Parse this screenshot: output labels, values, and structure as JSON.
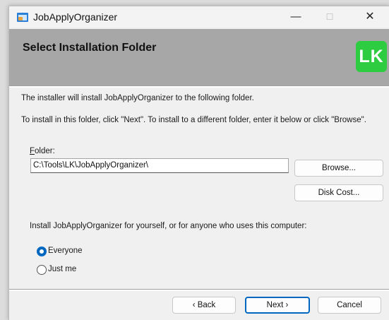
{
  "window": {
    "title": "JobApplyOrganizer",
    "controls": {
      "minimize": "—",
      "maximize": "☐",
      "close": "✕"
    }
  },
  "banner": {
    "title": "Select Installation Folder",
    "logo_text": "LK",
    "logo_color": "#2ecc40",
    "background": "#a7a7a7"
  },
  "body": {
    "intro": "The installer will install JobApplyOrganizer to the following folder.",
    "instructions": "To install in this folder, click \"Next\". To install to a different folder, enter it below or click \"Browse\".",
    "folder_label_accel": "F",
    "folder_label_rest": "older:",
    "folder_value": "C:\\Tools\\LK\\JobApplyOrganizer\\",
    "browse_label": "Browse...",
    "disk_cost_label": "Disk Cost...",
    "install_for_question": "Install JobApplyOrganizer for yourself, or for anyone who uses this computer:",
    "options": [
      {
        "label": "Everyone",
        "selected": true
      },
      {
        "label": "Just me",
        "selected": false
      }
    ]
  },
  "footer": {
    "back_label": "‹ Back",
    "next_label": "Next ›",
    "cancel_label": "Cancel"
  },
  "colors": {
    "accent": "#0067c0",
    "dialog_bg": "#f0f0f0"
  }
}
